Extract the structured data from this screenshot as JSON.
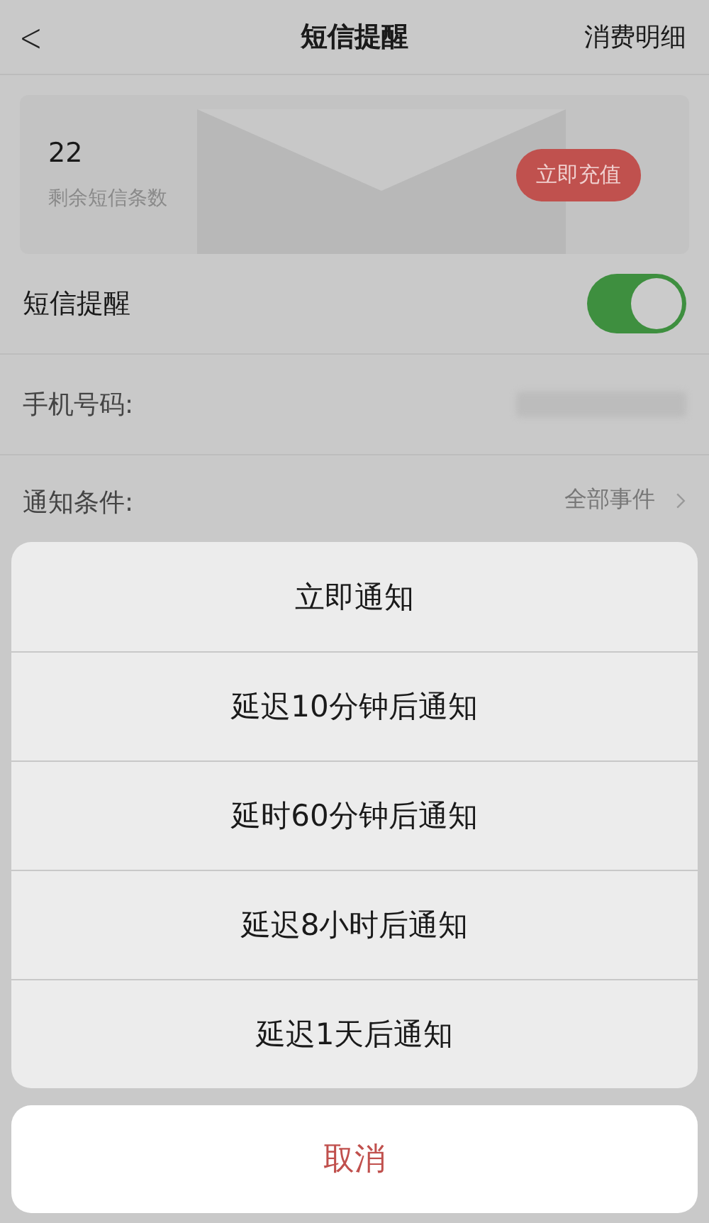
{
  "header": {
    "back": "<",
    "title": "短信提醒",
    "action": "消费明细"
  },
  "balance": {
    "count": "22",
    "label": "剩余短信条数",
    "button": "立即充值"
  },
  "settings": {
    "sms_alert": {
      "label": "短信提醒",
      "on": true
    },
    "phone": {
      "label": "手机号码:"
    },
    "condition": {
      "label": "通知条件:",
      "value": "全部事件"
    }
  },
  "action_sheet": {
    "options": [
      {
        "label": "立即通知"
      },
      {
        "label": "延迟10分钟后通知"
      },
      {
        "label": "延时60分钟后通知"
      },
      {
        "label": "延迟8小时后通知"
      },
      {
        "label": "延迟1天后通知"
      }
    ],
    "cancel": "取消"
  }
}
